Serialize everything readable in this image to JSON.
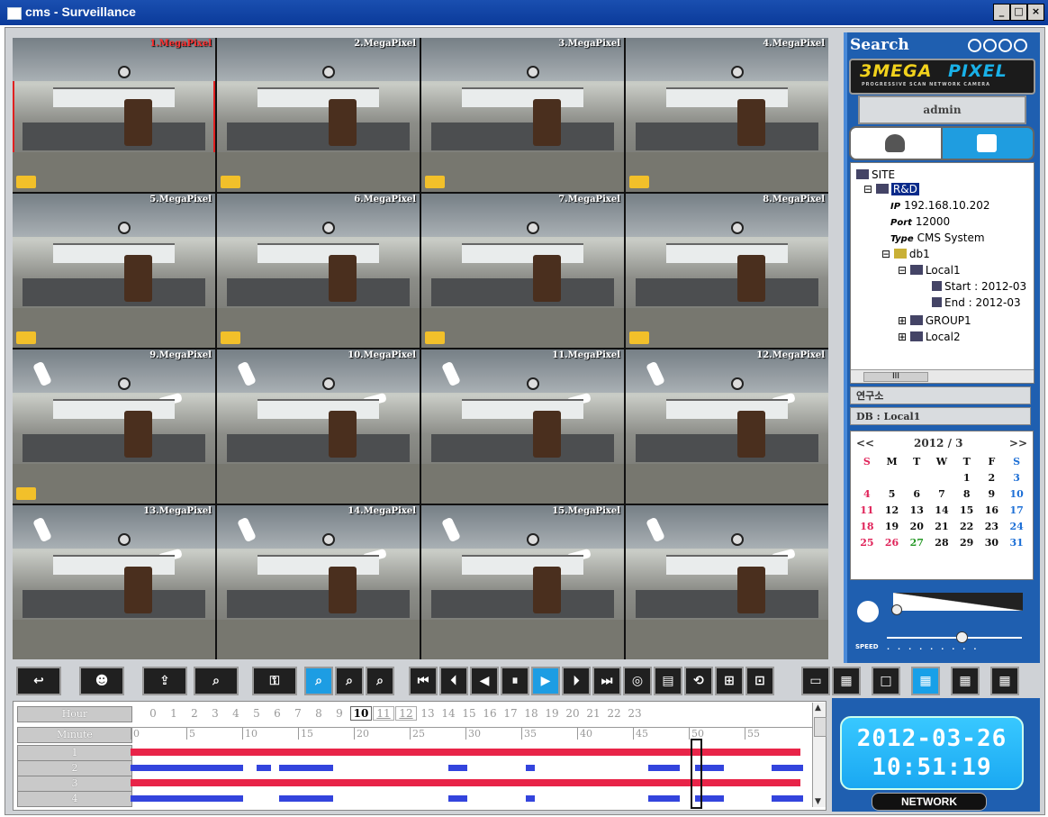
{
  "window": {
    "title": "cms - Surveillance",
    "min": "_",
    "max": "□",
    "close": "×"
  },
  "cameras": [
    {
      "label": "1.MegaPixel",
      "selected": true
    },
    {
      "label": "2.MegaPixel"
    },
    {
      "label": "3.MegaPixel"
    },
    {
      "label": "4.MegaPixel"
    },
    {
      "label": "5.MegaPixel"
    },
    {
      "label": "6.MegaPixel"
    },
    {
      "label": "7.MegaPixel"
    },
    {
      "label": "8.MegaPixel"
    },
    {
      "label": "9.MegaPixel"
    },
    {
      "label": "10.MegaPixel"
    },
    {
      "label": "11.MegaPixel"
    },
    {
      "label": "12.MegaPixel"
    },
    {
      "label": "13.MegaPixel"
    },
    {
      "label": "14.MegaPixel"
    },
    {
      "label": "15.MegaPixel"
    },
    {
      "label": ""
    }
  ],
  "panel": {
    "search_label": "Search",
    "logo_left": "3MEGA",
    "logo_right": "PIXEL",
    "logo_sub": "PROGRESSIVE SCAN   NETWORK CAMERA",
    "user": "admin",
    "tree": {
      "site": "SITE",
      "rd": "R&D",
      "ip_key": "IP",
      "ip": "192.168.10.202",
      "port_key": "Port",
      "port": "12000",
      "type_key": "Type",
      "type": "CMS System",
      "db": "db1",
      "local1": "Local1",
      "start": "Start : 2012-03",
      "end": "End : 2012-03",
      "group1": "GROUP1",
      "local2": "Local2",
      "scroll_thumb": "III"
    },
    "site_name": "연구소",
    "db_label": "DB : Local1",
    "calendar": {
      "prev": "<<",
      "next": ">>",
      "month": "2012 / 3",
      "weekdays": [
        "S",
        "M",
        "T",
        "W",
        "T",
        "F",
        "S"
      ],
      "weeks": [
        [
          "",
          "",
          "",
          "",
          "1",
          "2",
          "3"
        ],
        [
          "4",
          "5",
          "6",
          "7",
          "8",
          "9",
          "10"
        ],
        [
          "11",
          "12",
          "13",
          "14",
          "15",
          "16",
          "17"
        ],
        [
          "18",
          "19",
          "20",
          "21",
          "22",
          "23",
          "24"
        ],
        [
          "25",
          "26",
          "27",
          "28",
          "29",
          "30",
          "31"
        ]
      ]
    },
    "speed_label": "SPEED"
  },
  "timeline": {
    "hour_label": "Hour",
    "minute_label": "Minute",
    "hours": [
      "0",
      "1",
      "2",
      "3",
      "4",
      "5",
      "6",
      "7",
      "8",
      "9",
      "10",
      "11",
      "12",
      "13",
      "14",
      "15",
      "16",
      "17",
      "18",
      "19",
      "20",
      "21",
      "22",
      "23"
    ],
    "minutes": [
      "0",
      "5",
      "10",
      "15",
      "20",
      "25",
      "30",
      "35",
      "40",
      "45",
      "50",
      "55"
    ],
    "rows": [
      "1",
      "2",
      "3",
      "4"
    ],
    "row2_segments": [
      [
        13,
        138
      ],
      [
        153,
        169
      ],
      [
        178,
        238
      ],
      [
        366,
        387
      ],
      [
        452,
        462
      ],
      [
        588,
        623
      ],
      [
        640,
        672
      ],
      [
        725,
        760
      ]
    ],
    "row4_segments": [
      [
        13,
        138
      ],
      [
        178,
        238
      ],
      [
        366,
        387
      ],
      [
        452,
        462
      ],
      [
        588,
        623
      ],
      [
        640,
        672
      ],
      [
        725,
        760
      ]
    ]
  },
  "clock": {
    "date": "2012-03-26",
    "time": "10:51:19",
    "network": "NETWORK"
  }
}
